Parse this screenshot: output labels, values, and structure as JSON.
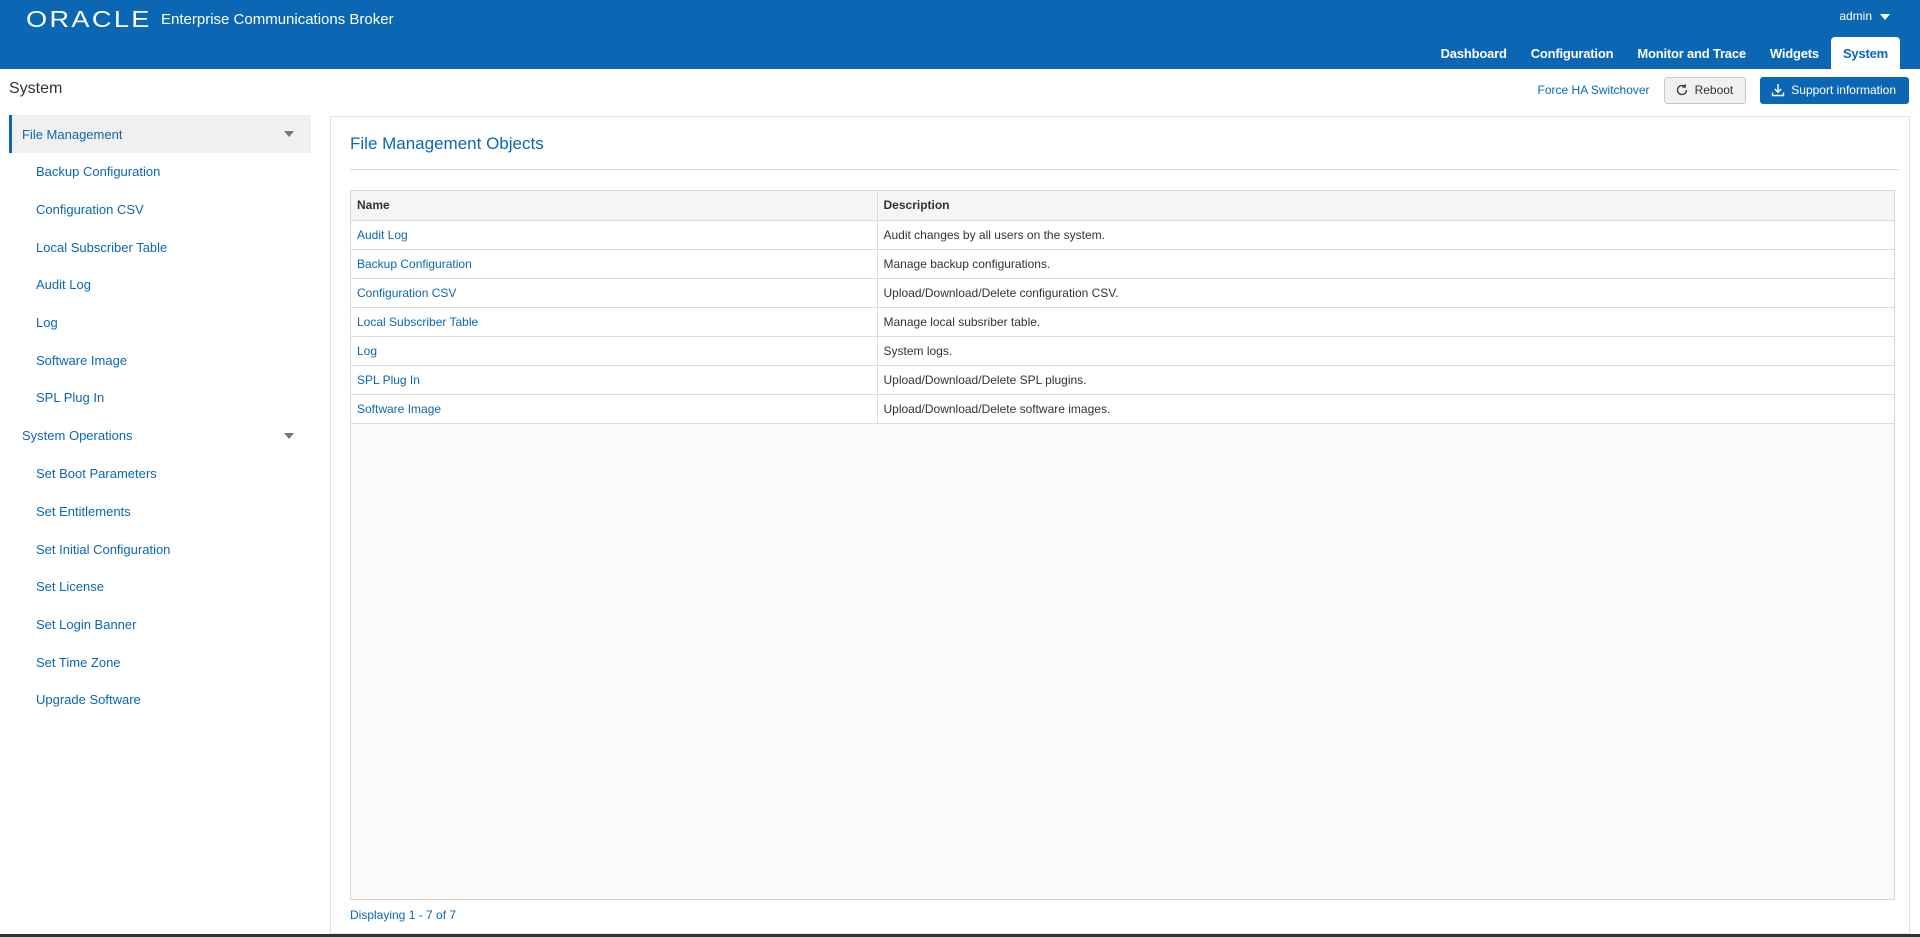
{
  "header": {
    "logo": "ORACLE",
    "product": "Enterprise Communications Broker",
    "user": "admin",
    "tabs": [
      {
        "label": "Dashboard",
        "active": false
      },
      {
        "label": "Configuration",
        "active": false
      },
      {
        "label": "Monitor and Trace",
        "active": false
      },
      {
        "label": "Widgets",
        "active": false
      },
      {
        "label": "System",
        "active": true
      }
    ]
  },
  "page": {
    "title": "System",
    "actions": {
      "force_ha": "Force HA Switchover",
      "reboot": "Reboot",
      "support": "Support information"
    }
  },
  "sidebar": {
    "groups": [
      {
        "label": "File Management",
        "items": [
          "Backup Configuration",
          "Configuration CSV",
          "Local Subscriber Table",
          "Audit Log",
          "Log",
          "Software Image",
          "SPL Plug In"
        ]
      },
      {
        "label": "System Operations",
        "items": [
          "Set Boot Parameters",
          "Set Entitlements",
          "Set Initial Configuration",
          "Set License",
          "Set Login Banner",
          "Set Time Zone",
          "Upgrade Software"
        ]
      }
    ]
  },
  "main": {
    "title": "File Management Objects",
    "columns": [
      "Name",
      "Description"
    ],
    "rows": [
      {
        "name": "Audit Log",
        "description": "Audit changes by all users on the system."
      },
      {
        "name": "Backup Configuration",
        "description": "Manage backup configurations."
      },
      {
        "name": "Configuration CSV",
        "description": "Upload/Download/Delete configuration CSV."
      },
      {
        "name": "Local Subscriber Table",
        "description": "Manage local subsriber table."
      },
      {
        "name": "Log",
        "description": "System logs."
      },
      {
        "name": "SPL Plug In",
        "description": "Upload/Download/Delete SPL plugins."
      },
      {
        "name": "Software Image",
        "description": "Upload/Download/Delete software images."
      }
    ],
    "pager": "Displaying 1 - 7 of 7"
  },
  "colors": {
    "brand": "#0b67b3",
    "text": "#333333",
    "border": "#dcdcdc"
  }
}
